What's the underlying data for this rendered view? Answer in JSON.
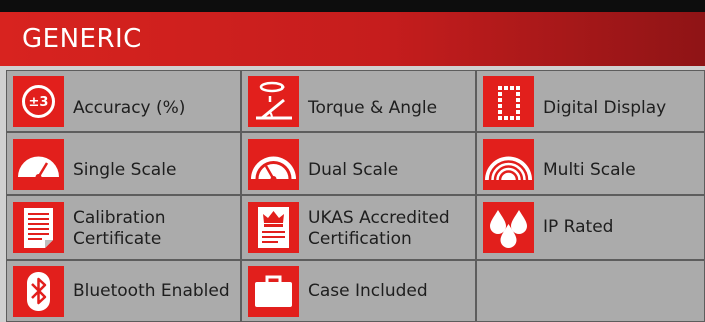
{
  "header": {
    "title": "GENERIC"
  },
  "features": [
    {
      "label": "Accuracy (%)",
      "icon": "accuracy-plus-minus-3-icon",
      "icon_text": "±3"
    },
    {
      "label": "Torque & Angle",
      "icon": "torque-angle-icon"
    },
    {
      "label": "Digital Display",
      "icon": "digital-display-icon"
    },
    {
      "label": "Single Scale",
      "icon": "single-scale-gauge-icon"
    },
    {
      "label": "Dual Scale",
      "icon": "dual-scale-gauge-icon"
    },
    {
      "label": "Multi Scale",
      "icon": "multi-scale-gauge-icon"
    },
    {
      "label_line1": "Calibration",
      "label_line2": "Certificate",
      "icon": "calibration-certificate-icon"
    },
    {
      "label_line1": "UKAS Accredited",
      "label_line2": "Certification",
      "icon": "ukas-crown-certificate-icon"
    },
    {
      "label": "IP Rated",
      "icon": "water-drops-icon"
    },
    {
      "label": "Bluetooth Enabled",
      "icon": "bluetooth-icon"
    },
    {
      "label": "Case Included",
      "icon": "carry-case-icon"
    }
  ],
  "colors": {
    "header_red": "#d8231f",
    "icon_red": "#e21f1c",
    "cell_grey": "#ababab"
  }
}
